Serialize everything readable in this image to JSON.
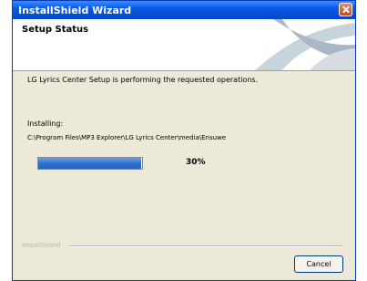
{
  "window": {
    "title": "InstallShield Wizard"
  },
  "header": {
    "title": "Setup Status"
  },
  "body": {
    "status_text": "LG Lyrics Center Setup is performing the requested operations.",
    "installing_label": "Installing:",
    "current_path": "C:\\Program Files\\MP3 Explorer\\LG Lyrics Center\\media\\Ensuwe",
    "progress_percent": 30,
    "progress_label": "30%"
  },
  "footer": {
    "brand": "InstallShield",
    "cancel_label": "Cancel"
  },
  "colors": {
    "title_bar": "#0a5ae6",
    "progress_fill": "#2d6fd0",
    "dialog_background": "#ece9d8"
  },
  "icons": {
    "close": "close-icon",
    "header_graphic": "header-swoosh-graphic"
  }
}
